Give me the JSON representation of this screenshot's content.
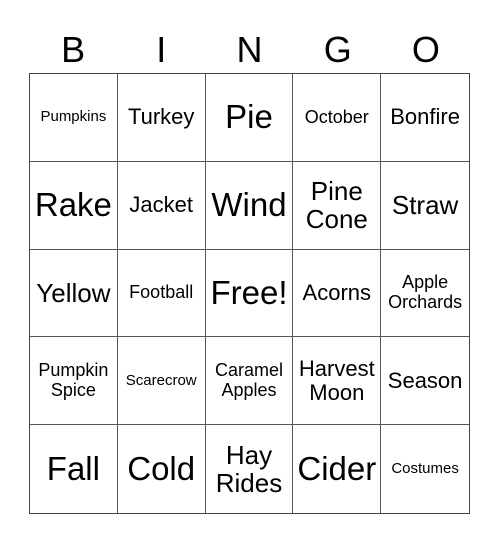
{
  "header": [
    "B",
    "I",
    "N",
    "G",
    "O"
  ],
  "cells": [
    {
      "text": "Pumpkins",
      "size": "s1"
    },
    {
      "text": "Turkey",
      "size": "s3"
    },
    {
      "text": "Pie",
      "size": "s5"
    },
    {
      "text": "October",
      "size": "s2"
    },
    {
      "text": "Bonfire",
      "size": "s3"
    },
    {
      "text": "Rake",
      "size": "s5"
    },
    {
      "text": "Jacket",
      "size": "s3"
    },
    {
      "text": "Wind",
      "size": "s5"
    },
    {
      "text": "Pine Cone",
      "size": "s4"
    },
    {
      "text": "Straw",
      "size": "s4"
    },
    {
      "text": "Yellow",
      "size": "s4"
    },
    {
      "text": "Football",
      "size": "s2"
    },
    {
      "text": "Free!",
      "size": "s5"
    },
    {
      "text": "Acorns",
      "size": "s3"
    },
    {
      "text": "Apple Orchards",
      "size": "s2"
    },
    {
      "text": "Pumpkin Spice",
      "size": "s2"
    },
    {
      "text": "Scarecrow",
      "size": "s1"
    },
    {
      "text": "Caramel Apples",
      "size": "s2"
    },
    {
      "text": "Harvest Moon",
      "size": "s3"
    },
    {
      "text": "Season",
      "size": "s3"
    },
    {
      "text": "Fall",
      "size": "s5"
    },
    {
      "text": "Cold",
      "size": "s5"
    },
    {
      "text": "Hay Rides",
      "size": "s4"
    },
    {
      "text": "Cider",
      "size": "s5"
    },
    {
      "text": "Costumes",
      "size": "s1"
    }
  ]
}
